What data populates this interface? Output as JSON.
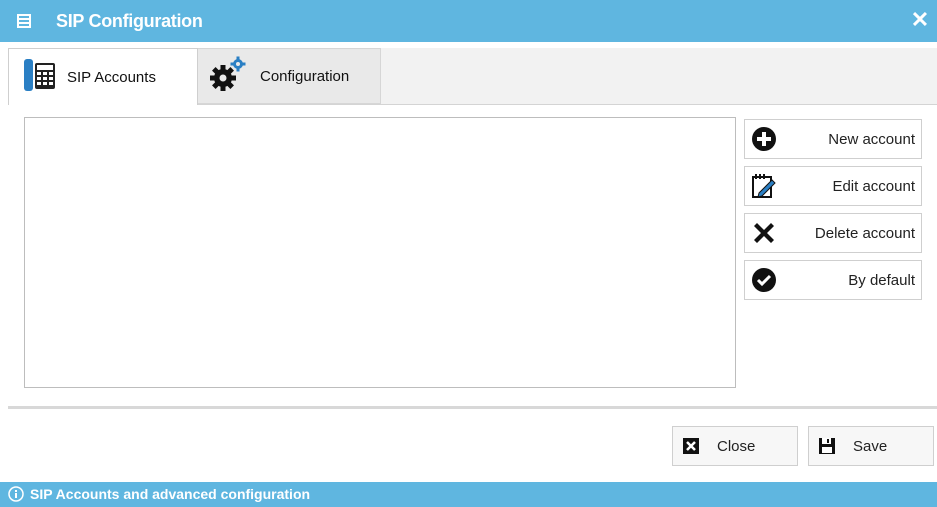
{
  "window": {
    "title": "SIP Configuration",
    "close_glyph": "✕",
    "app_icon": "address-book-icon"
  },
  "tabs": [
    {
      "label": "SIP Accounts",
      "icon": "phone-keypad-icon",
      "active": true
    },
    {
      "label": "Configuration",
      "icon": "gears-icon",
      "active": false
    }
  ],
  "accounts_list": {
    "items": []
  },
  "actions": [
    {
      "label": "New account",
      "icon": "plus-circle-icon"
    },
    {
      "label": "Edit account",
      "icon": "edit-note-icon"
    },
    {
      "label": "Delete account",
      "icon": "delete-x-icon"
    },
    {
      "label": "By default",
      "icon": "check-circle-icon"
    }
  ],
  "footer": {
    "close_label": "Close",
    "save_label": "Save"
  },
  "status": {
    "text": "SIP Accounts and advanced configuration",
    "icon": "info-icon"
  },
  "colors": {
    "accent": "#5fb6e0"
  }
}
